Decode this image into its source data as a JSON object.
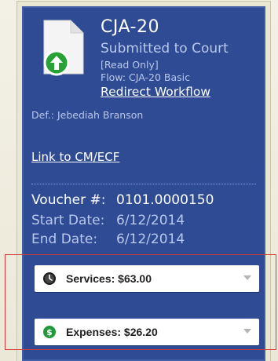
{
  "form": {
    "title": "CJA-20",
    "status": "Submitted to Court",
    "mode": "[Read Only]",
    "flow": "Flow: CJA-20 Basic",
    "redirect_link": "Redirect Workflow",
    "defendant": "Def.: Jebediah Branson",
    "cmecf_link": "Link to CM/ECF"
  },
  "voucher": {
    "number_label": "Voucher #:",
    "number_value": "0101.0000150",
    "start_label": "Start Date:",
    "start_value": "6/12/2014",
    "end_label": "End Date:",
    "end_value": "6/12/2014"
  },
  "totals": {
    "services_label": "Services: $63.00",
    "expenses_label": "Expenses: $26.20"
  },
  "icons": {
    "document": "document-upload-icon",
    "services": "clock-icon",
    "expenses": "dollar-icon",
    "dropdown": "chevron-down-icon"
  },
  "colors": {
    "panel": "#2e4b93",
    "upload_badge": "#27a336",
    "expenses_icon": "#1f9a3a",
    "highlight": "#d23a3a"
  }
}
